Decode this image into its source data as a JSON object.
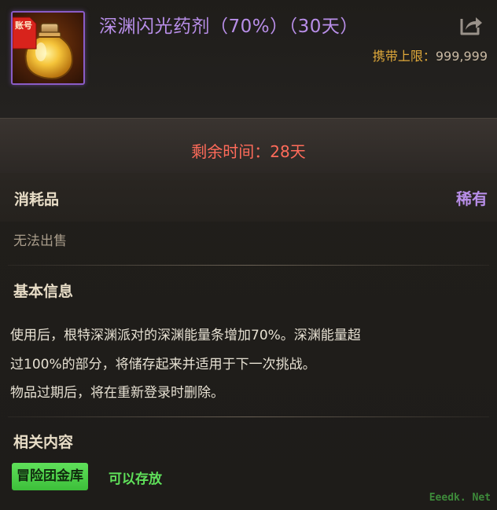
{
  "item": {
    "name": "深渊闪光药剂（70%）（30天）",
    "badge": "账号",
    "icon": "golden-potion-bottle-icon"
  },
  "header": {
    "carry_limit_label": "携带上限：",
    "carry_limit_value": "999,999",
    "share_icon": "share-arrow-icon"
  },
  "remaining_time": "剩余时间：28天",
  "category": "消耗品",
  "rarity": "稀有",
  "sell_status": "无法出售",
  "basic_info": {
    "title": "基本信息",
    "lines": [
      "使用后，根特深渊派对的深渊能量条增加70%。深渊能量超",
      "过100%的部分，将储存起来并适用于下一次挑战。",
      "物品过期后，将在重新登录时删除。"
    ]
  },
  "related": {
    "title": "相关内容",
    "storage_tag": "冒险团金库",
    "storage_status": "可以存放"
  },
  "watermark": "Eeedk. Net",
  "colors": {
    "title_purple": "#b88ee8",
    "time_red": "#ff6b5a",
    "limit_gold": "#e0a93a",
    "storage_green": "#5fe05a"
  }
}
